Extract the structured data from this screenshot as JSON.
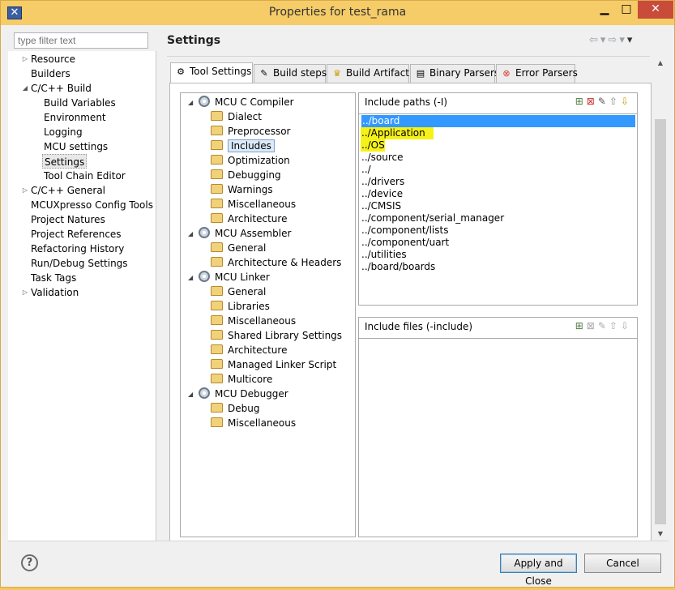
{
  "window": {
    "title": "Properties for test_rama"
  },
  "filter": {
    "placeholder": "type filter text"
  },
  "nav": {
    "items": [
      {
        "label": "Resource",
        "expandable": true
      },
      {
        "label": "Builders"
      },
      {
        "label": "C/C++ Build",
        "expanded": true
      },
      {
        "label": "Build Variables"
      },
      {
        "label": "Environment"
      },
      {
        "label": "Logging"
      },
      {
        "label": "MCU settings"
      },
      {
        "label": "Settings",
        "selected": true
      },
      {
        "label": "Tool Chain Editor"
      },
      {
        "label": "C/C++ General",
        "expandable": true
      },
      {
        "label": "MCUXpresso Config Tools"
      },
      {
        "label": "Project Natures"
      },
      {
        "label": "Project References"
      },
      {
        "label": "Refactoring History"
      },
      {
        "label": "Run/Debug Settings"
      },
      {
        "label": "Task Tags"
      },
      {
        "label": "Validation",
        "expandable": true
      }
    ]
  },
  "page": {
    "title": "Settings"
  },
  "tabs": [
    {
      "label": "Tool Settings",
      "icon": "tool-settings-icon"
    },
    {
      "label": "Build steps",
      "icon": "build-steps-icon"
    },
    {
      "label": "Build Artifact",
      "icon": "build-artifact-icon"
    },
    {
      "label": "Binary Parsers",
      "icon": "binary-parsers-icon"
    },
    {
      "label": "Error Parsers",
      "icon": "error-parsers-icon"
    }
  ],
  "tree": {
    "compiler": {
      "label": "MCU C Compiler",
      "children": [
        "Dialect",
        "Preprocessor",
        "Includes",
        "Optimization",
        "Debugging",
        "Warnings",
        "Miscellaneous",
        "Architecture"
      ]
    },
    "assembler": {
      "label": "MCU Assembler",
      "children": [
        "General",
        "Architecture & Headers"
      ]
    },
    "linker": {
      "label": "MCU Linker",
      "children": [
        "General",
        "Libraries",
        "Miscellaneous",
        "Shared Library Settings",
        "Architecture",
        "Managed Linker Script",
        "Multicore"
      ]
    },
    "debugger": {
      "label": "MCU Debugger",
      "children": [
        "Debug",
        "Miscellaneous"
      ]
    }
  },
  "include_paths": {
    "label": "Include paths (-I)",
    "paths": [
      "../board",
      "../Application",
      "../OS",
      "../source",
      "../",
      "../drivers",
      "../device",
      "../CMSIS",
      "../component/serial_manager",
      "../component/lists",
      "../component/uart",
      "../utilities",
      "../board/boards"
    ]
  },
  "include_files": {
    "label": "Include files (-include)"
  },
  "buttons": {
    "apply_close": "Apply and Close",
    "cancel": "Cancel",
    "help": "?"
  },
  "colors": {
    "titlebar": "#f6cc68",
    "selection": "#3399ff",
    "highlight": "#f4f000"
  }
}
